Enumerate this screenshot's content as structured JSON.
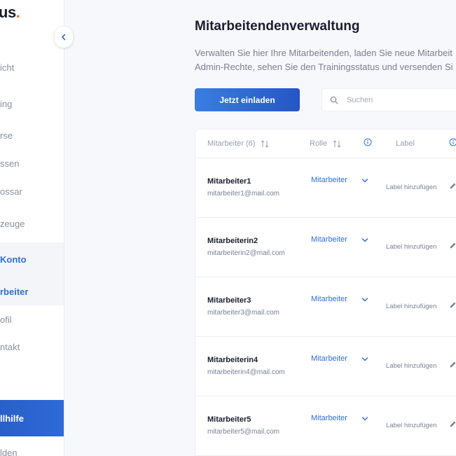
{
  "sidebar": {
    "logo_text": "us",
    "logo_dot": ".",
    "items": [
      {
        "label": "icht"
      },
      {
        "label": "ing"
      },
      {
        "label": "rse"
      },
      {
        "label": "ssen"
      },
      {
        "label": "ossar"
      },
      {
        "label": "zeuge"
      }
    ],
    "section_title": "Konto",
    "active_item": "rbeiter",
    "sub_items": [
      {
        "label": "ofil"
      },
      {
        "label": "ntakt"
      }
    ],
    "help_label": "llhilfe",
    "bottom_label": "lden"
  },
  "main": {
    "title": "Mitarbeitendenverwaltung",
    "description_line1": "Verwalten Sie hier Ihre Mitarbeitenden, laden Sie neue Mitarbeit",
    "description_line2": "Admin-Rechte, sehen Sie den Trainingsstatus und versenden Si",
    "invite_button": "Jetzt einladen",
    "search_placeholder": "Suchen"
  },
  "table": {
    "headers": {
      "employee": "Mitarbeiter (6)",
      "role": "Rolle",
      "label": "Label"
    },
    "rows": [
      {
        "name": "Mitarbeiter1",
        "email": "mitarbeiter1@mail.com",
        "role": "Mitarbeiter",
        "label": "Label hinzufügen"
      },
      {
        "name": "Mitarbeiterin2",
        "email": "mitarbeiterin2@mail.com",
        "role": "Mitarbeiter",
        "label": "Label hinzufügen"
      },
      {
        "name": "Mitarbeiter3",
        "email": "mitarbeiter3@mail.com",
        "role": "Mitarbeiter",
        "label": "Label hinzufügen"
      },
      {
        "name": "Mitarbeiterin4",
        "email": "mitarbeiterin4@mail.com",
        "role": "Mitarbeiter",
        "label": "Label hinzufügen"
      },
      {
        "name": "Mitarbeiter5",
        "email": "mitarbeiter5@mail.com",
        "role": "Mitarbeiter",
        "label": "Label hinzufügen"
      }
    ]
  },
  "colors": {
    "accent": "#2f6fd6",
    "brand_dot": "#ff6b2c",
    "help_bg": "#2a5fc9"
  },
  "icons": [
    "chevron-left-icon",
    "search-icon",
    "sort-icon",
    "info-icon",
    "chevron-down-icon",
    "pencil-icon"
  ]
}
